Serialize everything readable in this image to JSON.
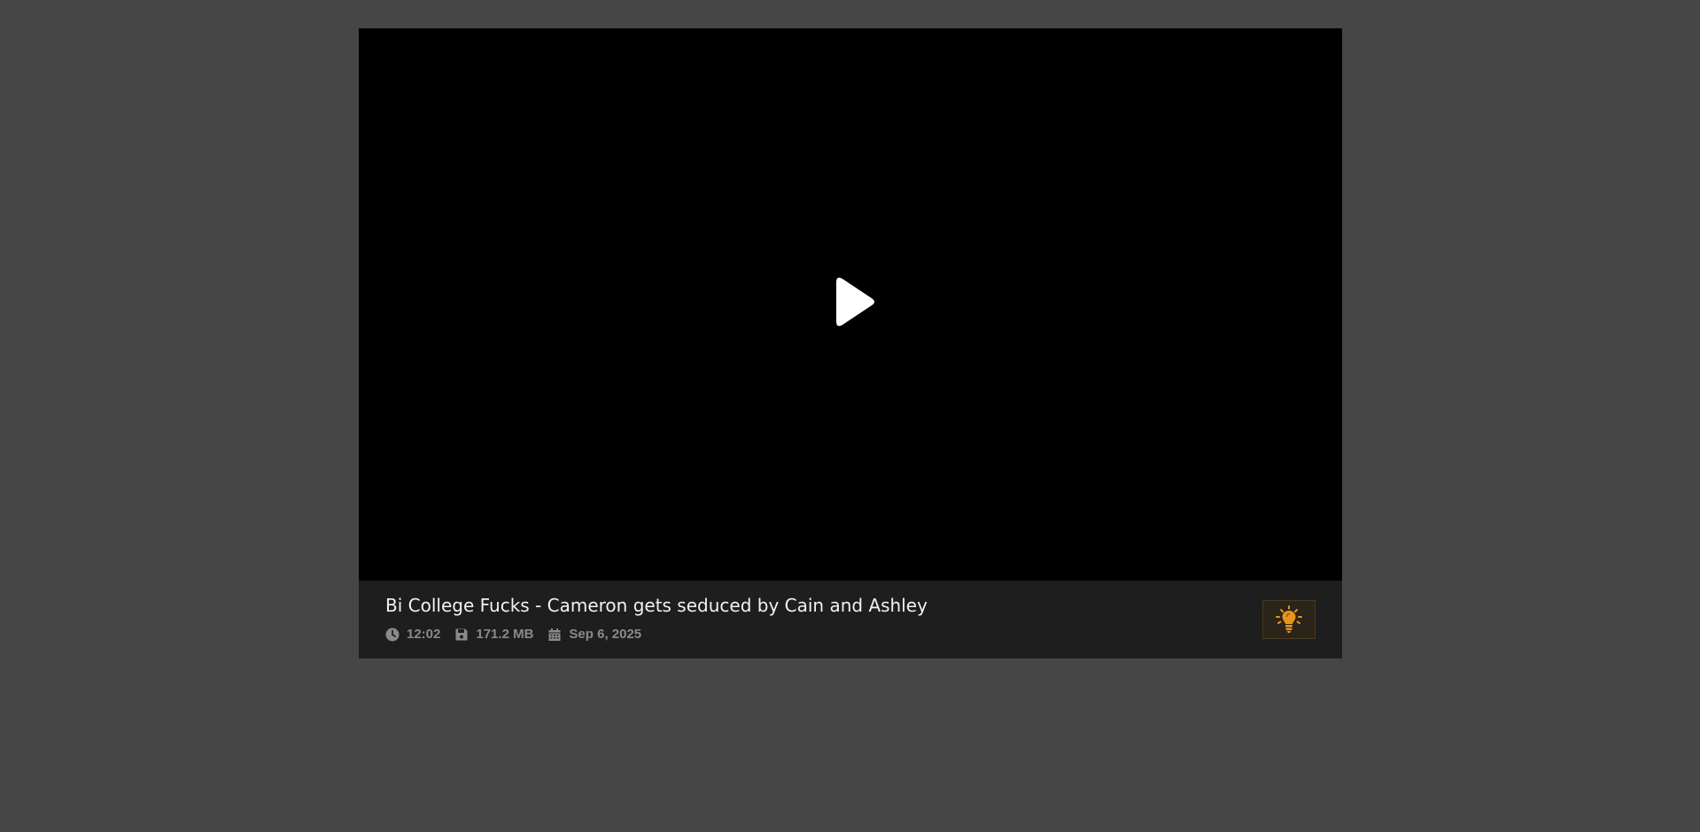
{
  "video": {
    "title": "Bi College Fucks - Cameron gets seduced by Cain and Ashley",
    "duration": "12:02",
    "file_size": "171.2 MB",
    "date": "Sep 6, 2025"
  },
  "icons": {
    "play": "play-icon",
    "duration": "clock-icon",
    "file_size": "floppy-disk-icon",
    "date": "calendar-icon",
    "light_toggle": "lightbulb-icon"
  },
  "colors": {
    "page_background": "#454645",
    "video_background": "#000000",
    "info_bar_background": "#1e1e1e",
    "meta_text": "#8a8a8a",
    "accent": "#e8941a"
  }
}
